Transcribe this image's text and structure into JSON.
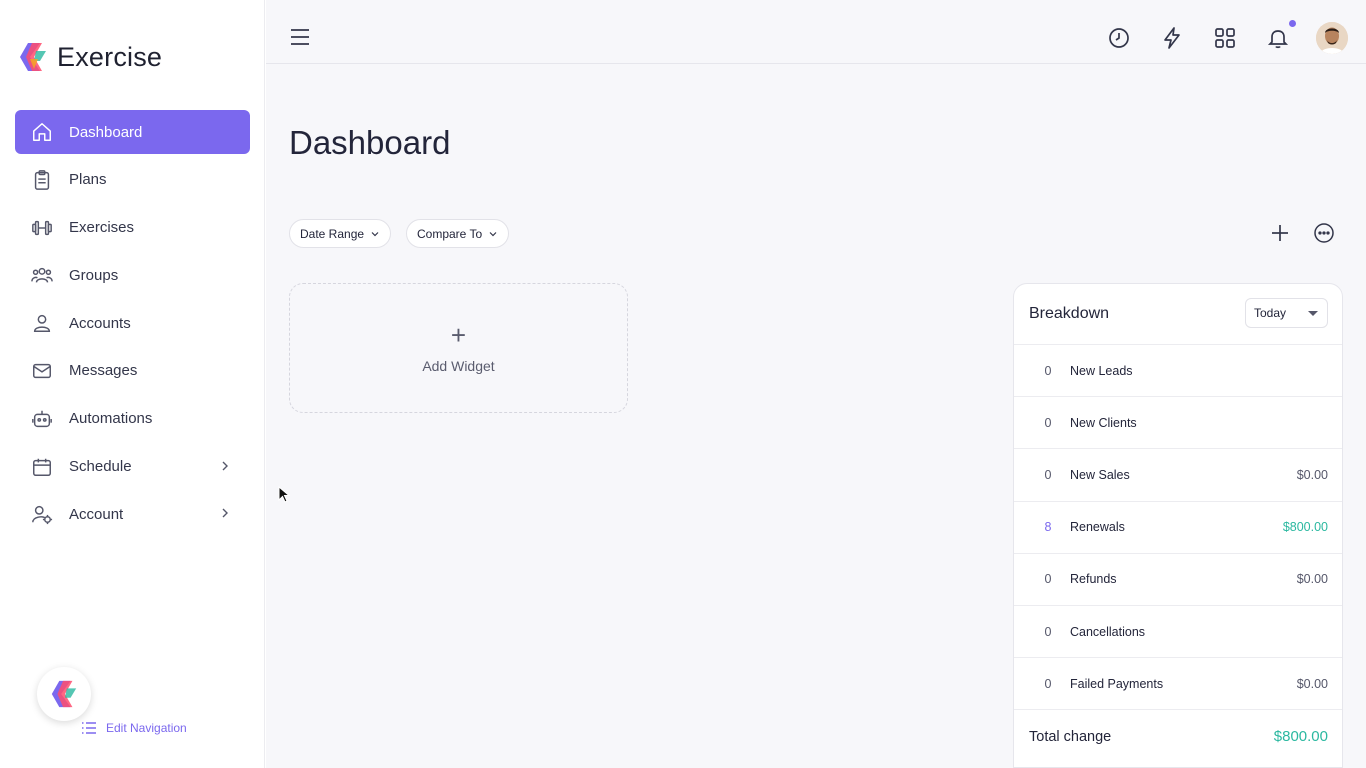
{
  "brand": {
    "name": "Exercise"
  },
  "sidebar": {
    "items": [
      {
        "label": "Dashboard",
        "icon": "home-icon",
        "active": true
      },
      {
        "label": "Plans",
        "icon": "clipboard-icon"
      },
      {
        "label": "Exercises",
        "icon": "dumbbell-icon"
      },
      {
        "label": "Groups",
        "icon": "users-icon"
      },
      {
        "label": "Accounts",
        "icon": "user-icon"
      },
      {
        "label": "Messages",
        "icon": "mail-icon"
      },
      {
        "label": "Automations",
        "icon": "robot-icon"
      },
      {
        "label": "Schedule",
        "icon": "calendar-icon",
        "expandable": true
      },
      {
        "label": "Account",
        "icon": "user-settings-icon",
        "expandable": true
      }
    ],
    "edit_navigation": "Edit Navigation"
  },
  "main": {
    "title": "Dashboard",
    "filters": {
      "date_range": "Date Range",
      "compare_to": "Compare To"
    },
    "add_widget": "Add Widget"
  },
  "breakdown": {
    "title": "Breakdown",
    "period": "Today",
    "rows": [
      {
        "count": "0",
        "label": "New Leads",
        "amount": ""
      },
      {
        "count": "0",
        "label": "New Clients",
        "amount": ""
      },
      {
        "count": "0",
        "label": "New Sales",
        "amount": "$0.00"
      },
      {
        "count": "8",
        "label": "Renewals",
        "amount": "$800.00"
      },
      {
        "count": "0",
        "label": "Refunds",
        "amount": "$0.00"
      },
      {
        "count": "0",
        "label": "Cancellations",
        "amount": ""
      },
      {
        "count": "0",
        "label": "Failed Payments",
        "amount": "$0.00"
      }
    ],
    "total_label": "Total change",
    "total_amount": "$800.00"
  },
  "colors": {
    "accent": "#7b68ee",
    "positive": "#2bb8a0"
  }
}
